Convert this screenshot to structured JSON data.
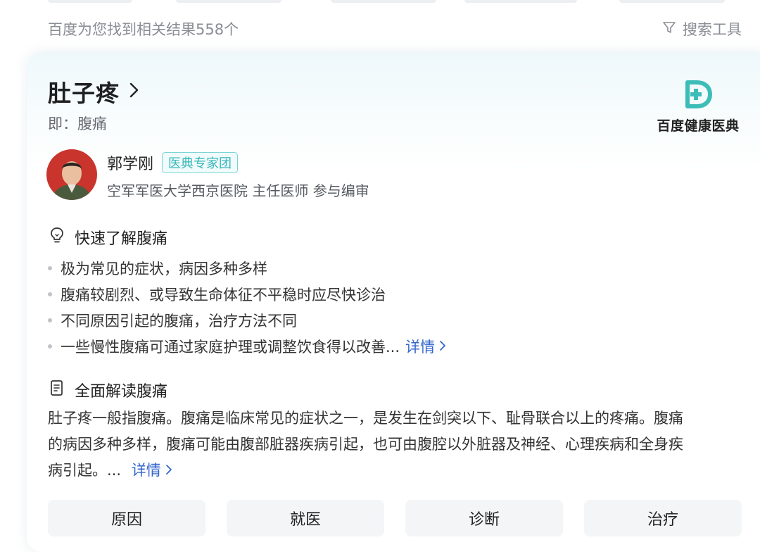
{
  "result_bar": {
    "count_text": "百度为您找到相关结果558个",
    "tools_label": "搜索工具"
  },
  "card": {
    "title": "肚子疼",
    "alias": "即：腹痛",
    "brand_name": "百度健康医典",
    "doctor": {
      "name": "郭学刚",
      "badge": "医典专家团",
      "title": "空军军医大学西京医院 主任医师 参与编审"
    },
    "quick": {
      "heading": "快速了解腹痛",
      "items": [
        "极为常见的症状，病因多种多样",
        "腹痛较剧烈、或导致生命体征不平稳时应尽快诊治",
        "不同原因引起的腹痛，治疗方法不同",
        "一些慢性腹痛可通过家庭护理或调整饮食得以改善..."
      ],
      "more": "详情"
    },
    "full": {
      "heading": "全面解读腹痛",
      "lines": [
        "肚子疼一般指腹痛。腹痛是临床常见的症状之一，是发生在剑突以下、耻骨联合以上的疼痛。腹痛",
        "的病因多种多样，腹痛可能由腹部脏器疾病引起，也可由腹腔以外脏器及神经、心理疾病和全身疾",
        "病引起。..."
      ],
      "more": "详情"
    },
    "tabs": [
      "原因",
      "就医",
      "诊断",
      "治疗"
    ]
  },
  "colors": {
    "accent_teal": "#35b6b8",
    "link_blue": "#3366cc",
    "tab_bg": "#f3f5f7"
  },
  "icons": {
    "filter": "filter-icon",
    "chevron": "chevron-right-icon",
    "bulb": "lightbulb-icon",
    "doc": "document-icon",
    "brand": "health-dictionary-logo-icon"
  }
}
